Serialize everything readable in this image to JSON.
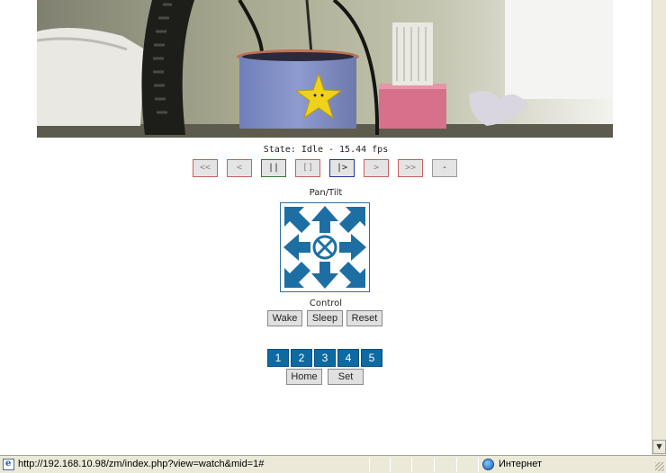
{
  "viewer": {
    "state_text": "State: Idle - 15.44 fps",
    "controls": [
      {
        "label": "<<",
        "name": "fast-rewind-button",
        "style": "red"
      },
      {
        "label": "<",
        "name": "step-back-button",
        "style": "red"
      },
      {
        "label": "||",
        "name": "pause-button",
        "style": "green"
      },
      {
        "label": "[]",
        "name": "stop-button",
        "style": "red"
      },
      {
        "label": "|>",
        "name": "play-button",
        "style": "blue"
      },
      {
        "label": ">",
        "name": "step-forward-button",
        "style": "red"
      },
      {
        "label": ">>",
        "name": "fast-forward-button",
        "style": "red"
      },
      {
        "label": "-",
        "name": "zoom-out-button",
        "style": "grey"
      }
    ]
  },
  "pantilt": {
    "title": "Pan/Tilt",
    "icons": [
      "up-left-arrow-icon",
      "up-arrow-icon",
      "up-right-arrow-icon",
      "left-arrow-icon",
      "center-icon",
      "right-arrow-icon",
      "down-left-arrow-icon",
      "down-arrow-icon",
      "down-right-arrow-icon"
    ]
  },
  "control": {
    "title": "Control",
    "wake_label": "Wake",
    "sleep_label": "Sleep",
    "reset_label": "Reset"
  },
  "presets": {
    "numbers": [
      "1",
      "2",
      "3",
      "4",
      "5"
    ],
    "home_label": "Home",
    "set_label": "Set"
  },
  "statusbar": {
    "url": "http://192.168.10.98/zm/index.php?view=watch&mid=1#",
    "zone": "Интернет"
  },
  "colors": {
    "preset_blue": "#0d6aa3",
    "arrow_blue": "#1d6fa3",
    "green_border": "#2f7a2f",
    "blue_border": "#2233aa",
    "red_border": "#c86060"
  }
}
